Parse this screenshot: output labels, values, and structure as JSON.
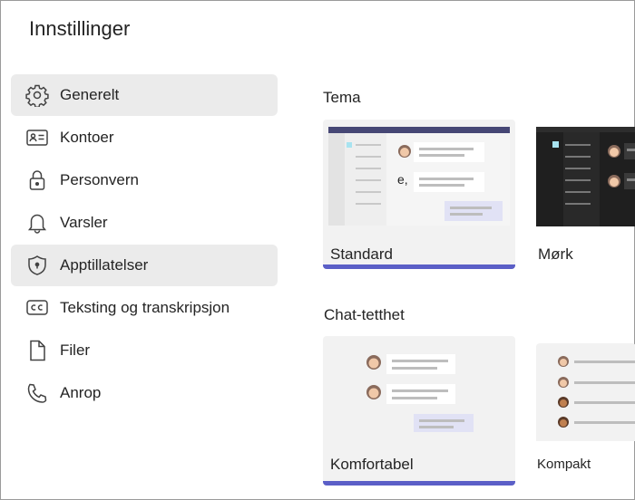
{
  "window": {
    "title": "Innstillinger"
  },
  "sidebar": {
    "items": [
      {
        "label": "Generelt",
        "icon": "gear-icon",
        "active": true
      },
      {
        "label": "Kontoer",
        "icon": "id-card-icon"
      },
      {
        "label": "Personvern",
        "icon": "lock-icon"
      },
      {
        "label": "Varsler",
        "icon": "bell-icon"
      },
      {
        "label": "Apptillatelser",
        "icon": "shield-icon",
        "highlighted": true
      },
      {
        "label": "Teksting og transkripsjon",
        "icon": "cc-icon"
      },
      {
        "label": "Filer",
        "icon": "file-icon"
      },
      {
        "label": "Anrop",
        "icon": "phone-icon"
      }
    ]
  },
  "theme": {
    "heading": "Tema",
    "options": [
      {
        "label": "Standard",
        "selected": true,
        "preview_text": "e,"
      },
      {
        "label": "Mørk",
        "selected": false
      }
    ]
  },
  "density": {
    "heading": "Chat-tetthet",
    "options": [
      {
        "label": "Komfortabel",
        "selected": true
      },
      {
        "label": "Kompakt",
        "selected": false
      }
    ]
  },
  "colors": {
    "accent": "#5b5fc7",
    "selected_bg": "#ebebeb",
    "text": "#242424"
  }
}
